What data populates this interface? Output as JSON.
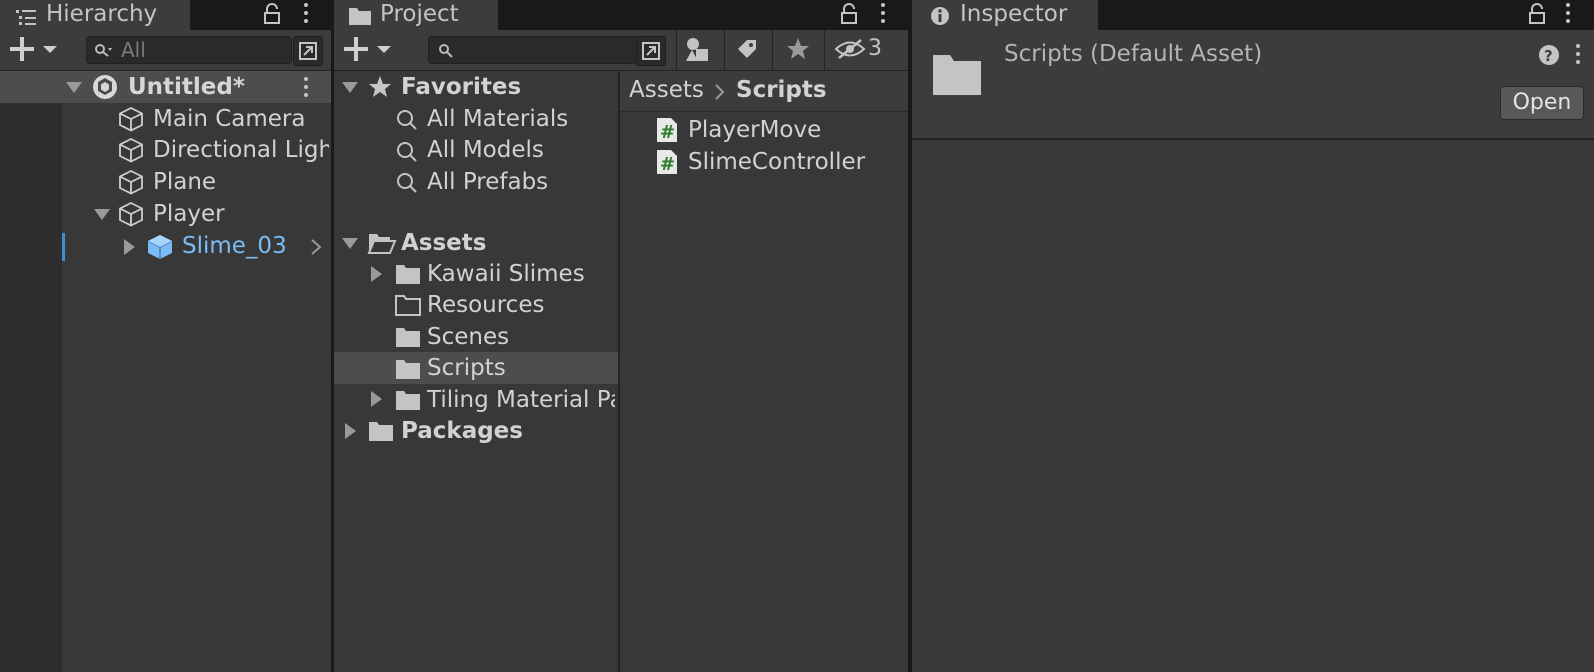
{
  "hierarchy": {
    "tab_label": "Hierarchy",
    "search_placeholder": "All",
    "scene": {
      "name": "Untitled*"
    },
    "items": [
      {
        "label": "Main Camera"
      },
      {
        "label": "Directional Light"
      },
      {
        "label": "Plane"
      },
      {
        "label": "Player"
      },
      {
        "label": "Slime_03"
      }
    ]
  },
  "project": {
    "tab_label": "Project",
    "hidden_count": "3",
    "favorites": {
      "label": "Favorites",
      "items": [
        {
          "label": "All Materials"
        },
        {
          "label": "All Models"
        },
        {
          "label": "All Prefabs"
        }
      ]
    },
    "assets": {
      "label": "Assets",
      "folders": [
        {
          "label": "Kawaii Slimes"
        },
        {
          "label": "Resources"
        },
        {
          "label": "Scenes"
        },
        {
          "label": "Scripts"
        },
        {
          "label": "Tiling Material Pack"
        }
      ]
    },
    "packages": {
      "label": "Packages"
    },
    "breadcrumb": {
      "root": "Assets",
      "current": "Scripts"
    },
    "files": [
      {
        "label": "PlayerMove",
        "icon": "csharp-script-icon"
      },
      {
        "label": "SlimeController",
        "icon": "csharp-script-icon"
      }
    ]
  },
  "inspector": {
    "tab_label": "Inspector",
    "title": "Scripts (Default Asset)",
    "open_button": "Open"
  },
  "colors": {
    "panel_bg": "#383838",
    "tab_bg": "#3c3c3c",
    "dark_bar": "#191919",
    "selected_row": "#4d4d4d",
    "prefab_blue": "#7bbcf5",
    "script_green": "#2b7a2b"
  }
}
